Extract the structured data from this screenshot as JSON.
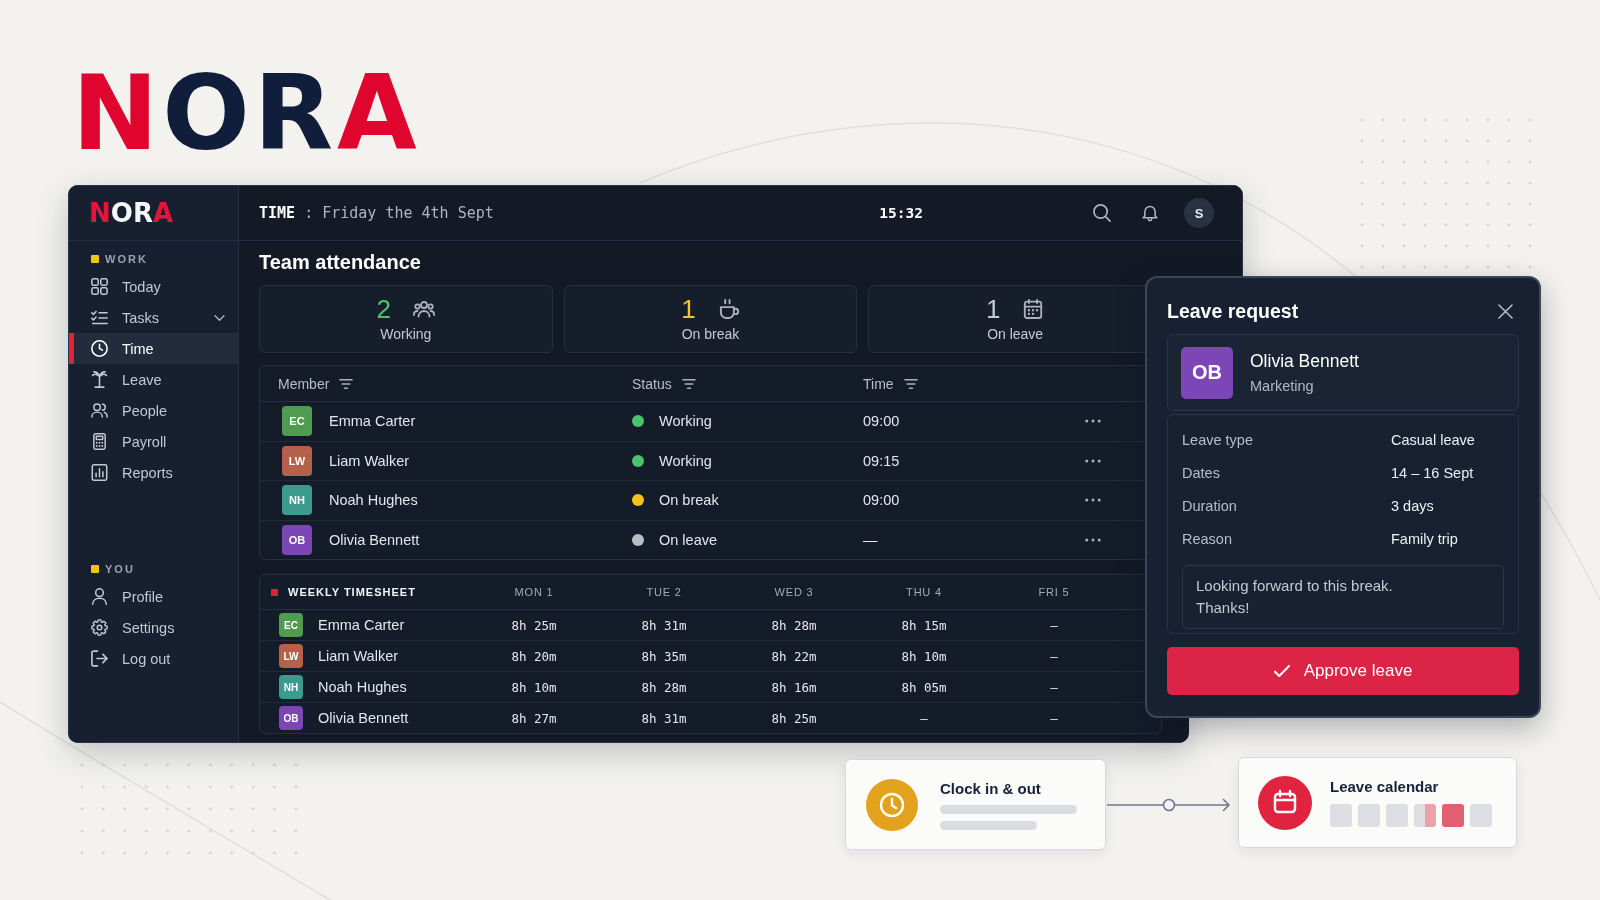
{
  "logo": "NORA",
  "app": {
    "sidebar": {
      "logo": "NORA",
      "sections": [
        {
          "title": "WORK",
          "items": [
            {
              "label": "Today",
              "kind": "link",
              "selected": false
            },
            {
              "label": "Tasks",
              "kind": "group",
              "selected": false
            },
            {
              "label": "Time",
              "kind": "link",
              "selected": true
            },
            {
              "label": "Leave",
              "kind": "link",
              "selected": false
            },
            {
              "label": "People",
              "kind": "link",
              "selected": false
            },
            {
              "label": "Payroll",
              "kind": "link",
              "selected": false
            },
            {
              "label": "Reports",
              "kind": "link",
              "selected": false
            }
          ]
        },
        {
          "title": "YOU",
          "items": [
            {
              "label": "Profile",
              "kind": "link",
              "selected": false
            },
            {
              "label": "Settings",
              "kind": "link",
              "selected": false
            },
            {
              "label": "Log out",
              "kind": "link",
              "selected": false
            }
          ]
        }
      ]
    },
    "topbar": {
      "title": "**TIME** : Friday the 4th Sept",
      "clock": "15:32",
      "user_initial": "S"
    },
    "attendance": {
      "title": "Team attendance",
      "stats": [
        {
          "value": "2",
          "label": "Working",
          "color": "#4fc26e"
        },
        {
          "value": "1",
          "label": "On break",
          "color": "#f6c623"
        },
        {
          "value": "1",
          "label": "On leave",
          "color": "#c3c7ce"
        }
      ],
      "table": {
        "columns": [
          "Member",
          "Status",
          "Time"
        ],
        "rows": [
          {
            "initials": "EC",
            "name": "Emma Carter",
            "color": "#4f9b50",
            "status": {
              "label": "Working",
              "color": "#4cc46c"
            },
            "time": "09:00"
          },
          {
            "initials": "LW",
            "name": "Liam Walker",
            "color": "#b5604a",
            "status": {
              "label": "Working",
              "color": "#4cc46c"
            },
            "time": "09:15"
          },
          {
            "initials": "NH",
            "name": "Noah Hughes",
            "color": "#3d9a8f",
            "status": {
              "label": "On break",
              "color": "#f4c21a"
            },
            "time": "09:00"
          },
          {
            "initials": "OB",
            "name": "Olivia Bennett",
            "color": "#7c46b6",
            "status": {
              "label": "On leave",
              "color": "#b9bdc4"
            },
            "time": "—"
          }
        ]
      }
    },
    "timesheet": {
      "title": "WEEKLY TIMESHEET",
      "days": [
        "MON 1",
        "TUE 2",
        "WED 3",
        "THU 4",
        "FRI 5"
      ],
      "rows": [
        {
          "initials": "EC",
          "name": "Emma Carter",
          "color": "#4f9b50",
          "hours": [
            "8h 25m",
            "8h 31m",
            "8h 28m",
            "8h 15m",
            "—"
          ]
        },
        {
          "initials": "LW",
          "name": "Liam Walker",
          "color": "#b5604a",
          "hours": [
            "8h 20m",
            "8h 35m",
            "8h 22m",
            "8h 10m",
            "—"
          ]
        },
        {
          "initials": "NH",
          "name": "Noah Hughes",
          "color": "#3d9a8f",
          "hours": [
            "8h 10m",
            "8h 28m",
            "8h 16m",
            "8h 05m",
            "—"
          ]
        },
        {
          "initials": "OB",
          "name": "Olivia Bennett",
          "color": "#7c46b6",
          "hours": [
            "8h 27m",
            "8h 31m",
            "8h 25m",
            "—",
            "—"
          ]
        }
      ]
    }
  },
  "leave_request": {
    "title": "Leave request",
    "employee": {
      "initials": "OB",
      "name": "Olivia Bennett",
      "department": "Marketing",
      "color": "#7c46b6"
    },
    "details": [
      {
        "label": "Leave type",
        "value": "Casual leave"
      },
      {
        "label": "Dates",
        "value": "14 – 16 Sept"
      },
      {
        "label": "Duration",
        "value": "3 days"
      },
      {
        "label": "Reason",
        "value": "Family trip"
      }
    ],
    "note": "Looking forward to this break.\nThanks!",
    "action": "Approve leave"
  },
  "features": [
    {
      "kind": "clock",
      "title": "Clock in & out",
      "color": "#e3a21d"
    },
    {
      "kind": "calendar",
      "title": "Leave calendar",
      "color": "#e0243f",
      "days": [
        {
          "kind": "free"
        },
        {
          "kind": "free"
        },
        {
          "kind": "free"
        },
        {
          "kind": "half"
        },
        {
          "kind": "leave"
        },
        {
          "kind": "free"
        }
      ]
    }
  ]
}
